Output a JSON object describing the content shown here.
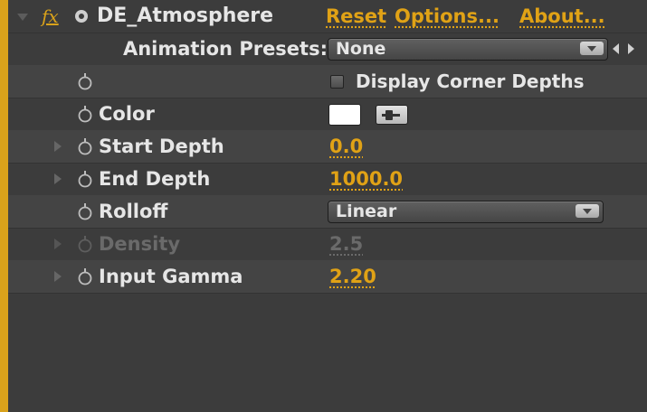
{
  "effect": {
    "fx_label": "fx",
    "name": "DE_Atmosphere",
    "links": {
      "reset": "Reset",
      "options": "Options...",
      "about": "About..."
    }
  },
  "animation_presets": {
    "label": "Animation Presets:",
    "value": "None"
  },
  "display_corner_depths": {
    "label": "Display Corner Depths",
    "checked": false
  },
  "color": {
    "label": "Color",
    "swatch_color": "#ffffff"
  },
  "start_depth": {
    "label": "Start Depth",
    "value": "0.0"
  },
  "end_depth": {
    "label": "End Depth",
    "value": "1000.0"
  },
  "rolloff": {
    "label": "Rolloff",
    "value": "Linear"
  },
  "density": {
    "label": "Density",
    "value": "2.5",
    "disabled": true
  },
  "input_gamma": {
    "label": "Input Gamma",
    "value": "2.20"
  },
  "colors": {
    "accent": "#e0a216",
    "panel_bg": "#3c3c3c",
    "edge": "#d9a21b"
  }
}
